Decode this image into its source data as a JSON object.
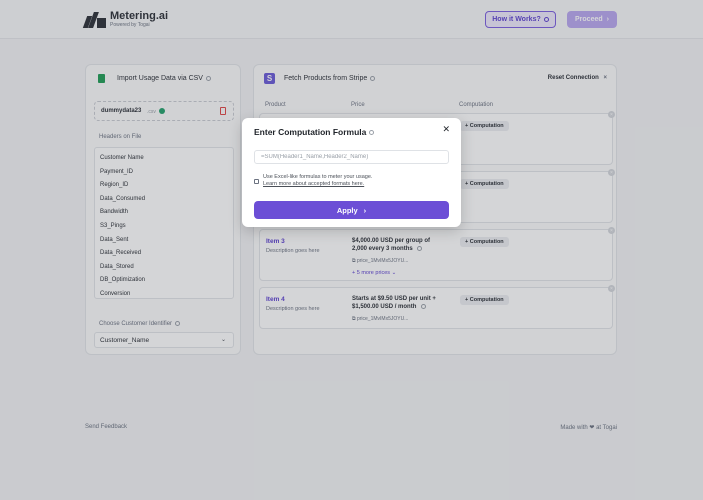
{
  "header": {
    "brand": "Metering.ai",
    "brand_sub": "Powered by Togai",
    "how_label": "How it Works?",
    "proceed_label": "Proceed"
  },
  "left_panel": {
    "title": "Import Usage Data via CSV",
    "file_name": "dummydata23",
    "file_ext": ".csv",
    "headers_label": "Headers on File",
    "headers": [
      "Customer Name",
      "Payment_ID",
      "Region_ID",
      "Data_Consumed",
      "Bandwidth",
      "S3_Pings",
      "Data_Sent",
      "Data_Received",
      "Data_Stored",
      "DB_Optimization",
      "Conversion"
    ],
    "customer_label": "Choose Customer Identifier",
    "customer_value": "Customer_Name"
  },
  "right_panel": {
    "title": "Fetch Products from Stripe",
    "reset_label": "Reset Connection",
    "columns": [
      "Product",
      "Price",
      "Computation"
    ],
    "items": [
      {
        "title": "Item 3",
        "desc": "Description goes here",
        "price": "$4,000.00 USD per group of 2,000 every 3 months",
        "price_id": "price_1MvIMx5JOYU...",
        "more": "+ 5 more prices",
        "computation": "Computation"
      },
      {
        "title": "Item 4",
        "desc": "Description goes here",
        "price": "Starts at $9.50 USD per unit + $1,500.00 USD / month",
        "price_id": "price_1MvIMx5JOYU...",
        "more": "",
        "computation": "Computation"
      }
    ],
    "hidden_computation_1": "Computation",
    "hidden_computation_2": "Computation"
  },
  "modal": {
    "title": "Enter Computation Formula",
    "placeholder": "=SUM(Header1_Name,Header2_Name)",
    "hint_line1": "Use Excel-like formulas to meter your usage.",
    "hint_line2": "Learn more about accepted formats here.",
    "apply_label": "Apply"
  },
  "footer": {
    "left": "Send Feedback",
    "right": "Made with ❤ at Togai"
  }
}
